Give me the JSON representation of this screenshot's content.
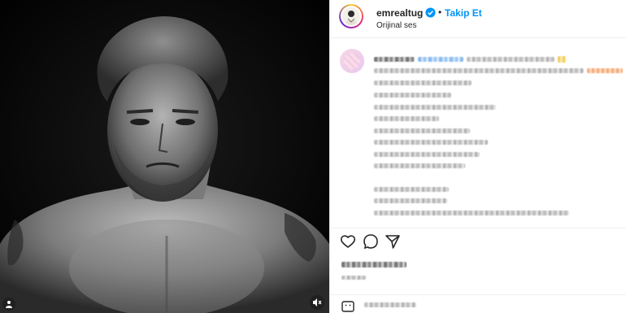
{
  "post": {
    "username": "emrealtug",
    "follow_label": "Takip Et",
    "separator": "•",
    "audio_label": "Orijinal ses"
  },
  "icons": {
    "verified": "verified-badge-icon",
    "like": "heart-icon",
    "comment": "comment-icon",
    "share": "paper-plane-icon",
    "mute": "speaker-muted-icon",
    "tag": "user-tag-icon",
    "emoji": "emoji-icon"
  },
  "colors": {
    "accent": "#0095f6",
    "text": "#262626",
    "border": "#efefef"
  }
}
